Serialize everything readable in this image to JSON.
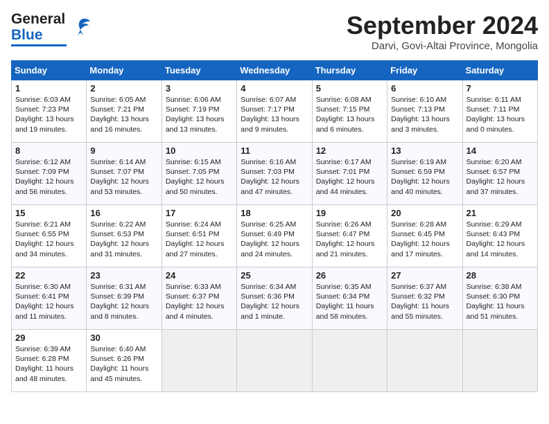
{
  "header": {
    "logo_general": "General",
    "logo_blue": "Blue",
    "month_title": "September 2024",
    "location": "Darvi, Govi-Altai Province, Mongolia"
  },
  "days_of_week": [
    "Sunday",
    "Monday",
    "Tuesday",
    "Wednesday",
    "Thursday",
    "Friday",
    "Saturday"
  ],
  "weeks": [
    [
      {
        "day": 1,
        "lines": [
          "Sunrise: 6:03 AM",
          "Sunset: 7:23 PM",
          "Daylight: 13 hours",
          "and 19 minutes."
        ]
      },
      {
        "day": 2,
        "lines": [
          "Sunrise: 6:05 AM",
          "Sunset: 7:21 PM",
          "Daylight: 13 hours",
          "and 16 minutes."
        ]
      },
      {
        "day": 3,
        "lines": [
          "Sunrise: 6:06 AM",
          "Sunset: 7:19 PM",
          "Daylight: 13 hours",
          "and 13 minutes."
        ]
      },
      {
        "day": 4,
        "lines": [
          "Sunrise: 6:07 AM",
          "Sunset: 7:17 PM",
          "Daylight: 13 hours",
          "and 9 minutes."
        ]
      },
      {
        "day": 5,
        "lines": [
          "Sunrise: 6:08 AM",
          "Sunset: 7:15 PM",
          "Daylight: 13 hours",
          "and 6 minutes."
        ]
      },
      {
        "day": 6,
        "lines": [
          "Sunrise: 6:10 AM",
          "Sunset: 7:13 PM",
          "Daylight: 13 hours",
          "and 3 minutes."
        ]
      },
      {
        "day": 7,
        "lines": [
          "Sunrise: 6:11 AM",
          "Sunset: 7:11 PM",
          "Daylight: 13 hours",
          "and 0 minutes."
        ]
      }
    ],
    [
      {
        "day": 8,
        "lines": [
          "Sunrise: 6:12 AM",
          "Sunset: 7:09 PM",
          "Daylight: 12 hours",
          "and 56 minutes."
        ]
      },
      {
        "day": 9,
        "lines": [
          "Sunrise: 6:14 AM",
          "Sunset: 7:07 PM",
          "Daylight: 12 hours",
          "and 53 minutes."
        ]
      },
      {
        "day": 10,
        "lines": [
          "Sunrise: 6:15 AM",
          "Sunset: 7:05 PM",
          "Daylight: 12 hours",
          "and 50 minutes."
        ]
      },
      {
        "day": 11,
        "lines": [
          "Sunrise: 6:16 AM",
          "Sunset: 7:03 PM",
          "Daylight: 12 hours",
          "and 47 minutes."
        ]
      },
      {
        "day": 12,
        "lines": [
          "Sunrise: 6:17 AM",
          "Sunset: 7:01 PM",
          "Daylight: 12 hours",
          "and 44 minutes."
        ]
      },
      {
        "day": 13,
        "lines": [
          "Sunrise: 6:19 AM",
          "Sunset: 6:59 PM",
          "Daylight: 12 hours",
          "and 40 minutes."
        ]
      },
      {
        "day": 14,
        "lines": [
          "Sunrise: 6:20 AM",
          "Sunset: 6:57 PM",
          "Daylight: 12 hours",
          "and 37 minutes."
        ]
      }
    ],
    [
      {
        "day": 15,
        "lines": [
          "Sunrise: 6:21 AM",
          "Sunset: 6:55 PM",
          "Daylight: 12 hours",
          "and 34 minutes."
        ]
      },
      {
        "day": 16,
        "lines": [
          "Sunrise: 6:22 AM",
          "Sunset: 6:53 PM",
          "Daylight: 12 hours",
          "and 31 minutes."
        ]
      },
      {
        "day": 17,
        "lines": [
          "Sunrise: 6:24 AM",
          "Sunset: 6:51 PM",
          "Daylight: 12 hours",
          "and 27 minutes."
        ]
      },
      {
        "day": 18,
        "lines": [
          "Sunrise: 6:25 AM",
          "Sunset: 6:49 PM",
          "Daylight: 12 hours",
          "and 24 minutes."
        ]
      },
      {
        "day": 19,
        "lines": [
          "Sunrise: 6:26 AM",
          "Sunset: 6:47 PM",
          "Daylight: 12 hours",
          "and 21 minutes."
        ]
      },
      {
        "day": 20,
        "lines": [
          "Sunrise: 6:28 AM",
          "Sunset: 6:45 PM",
          "Daylight: 12 hours",
          "and 17 minutes."
        ]
      },
      {
        "day": 21,
        "lines": [
          "Sunrise: 6:29 AM",
          "Sunset: 6:43 PM",
          "Daylight: 12 hours",
          "and 14 minutes."
        ]
      }
    ],
    [
      {
        "day": 22,
        "lines": [
          "Sunrise: 6:30 AM",
          "Sunset: 6:41 PM",
          "Daylight: 12 hours",
          "and 11 minutes."
        ]
      },
      {
        "day": 23,
        "lines": [
          "Sunrise: 6:31 AM",
          "Sunset: 6:39 PM",
          "Daylight: 12 hours",
          "and 8 minutes."
        ]
      },
      {
        "day": 24,
        "lines": [
          "Sunrise: 6:33 AM",
          "Sunset: 6:37 PM",
          "Daylight: 12 hours",
          "and 4 minutes."
        ]
      },
      {
        "day": 25,
        "lines": [
          "Sunrise: 6:34 AM",
          "Sunset: 6:36 PM",
          "Daylight: 12 hours",
          "and 1 minute."
        ]
      },
      {
        "day": 26,
        "lines": [
          "Sunrise: 6:35 AM",
          "Sunset: 6:34 PM",
          "Daylight: 11 hours",
          "and 58 minutes."
        ]
      },
      {
        "day": 27,
        "lines": [
          "Sunrise: 6:37 AM",
          "Sunset: 6:32 PM",
          "Daylight: 11 hours",
          "and 55 minutes."
        ]
      },
      {
        "day": 28,
        "lines": [
          "Sunrise: 6:38 AM",
          "Sunset: 6:30 PM",
          "Daylight: 11 hours",
          "and 51 minutes."
        ]
      }
    ],
    [
      {
        "day": 29,
        "lines": [
          "Sunrise: 6:39 AM",
          "Sunset: 6:28 PM",
          "Daylight: 11 hours",
          "and 48 minutes."
        ]
      },
      {
        "day": 30,
        "lines": [
          "Sunrise: 6:40 AM",
          "Sunset: 6:26 PM",
          "Daylight: 11 hours",
          "and 45 minutes."
        ]
      },
      null,
      null,
      null,
      null,
      null
    ]
  ]
}
